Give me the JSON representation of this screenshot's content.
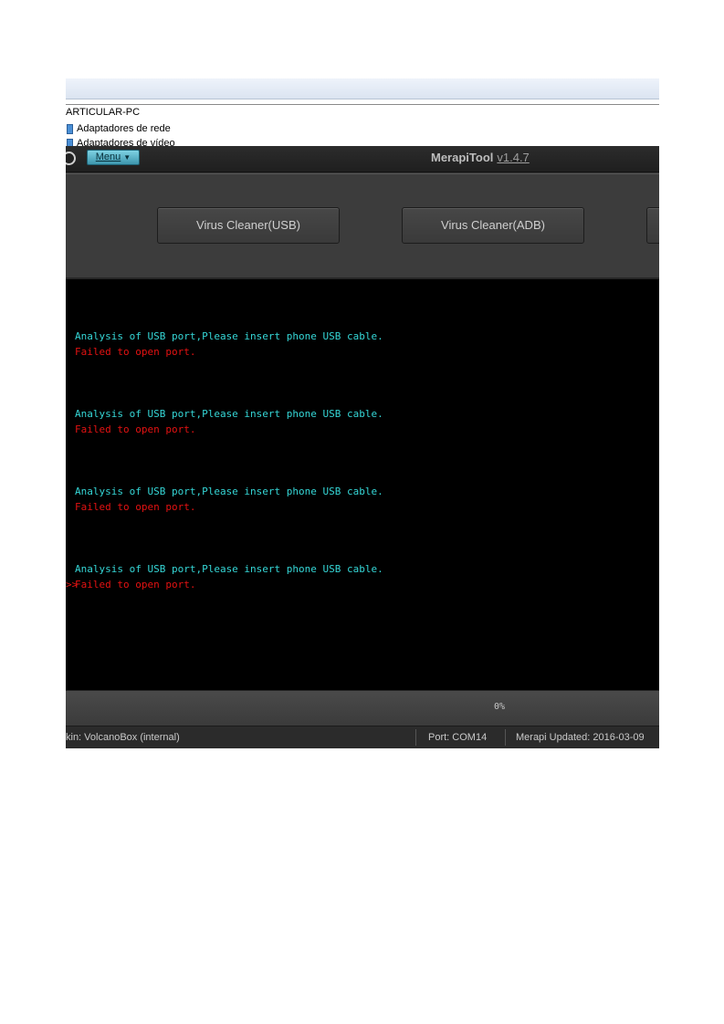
{
  "background_window": {
    "computer_name": "ARTICULAR-PC",
    "tree_items": [
      "Adaptadores de rede",
      "Adaptadores de vídeo"
    ]
  },
  "app": {
    "menu_label": "Menu",
    "title": "MerapiTool",
    "version": "v1.4.7",
    "toolbar": {
      "buttons": [
        "Virus Cleaner(USB)",
        "Virus Cleaner(ADB)"
      ]
    },
    "console": {
      "entries": [
        {
          "info": "Analysis of USB port,Please insert phone USB cable.",
          "error": "Failed to open port."
        },
        {
          "info": "Analysis of USB port,Please insert phone USB cable.",
          "error": "Failed to open port."
        },
        {
          "info": "Analysis of USB port,Please insert phone USB cable.",
          "error": "Failed to open port."
        },
        {
          "info": "Analysis of USB port,Please insert phone USB cable.",
          "error": "Failed to open port."
        }
      ],
      "prompt": ">>"
    },
    "progress": {
      "value": 0,
      "label": "0%"
    },
    "status": {
      "skin": "kin: VolcanoBox (internal)",
      "port": "Port: COM14",
      "updated": "Merapi Updated: 2016-03-09"
    }
  },
  "colors": {
    "console_info": "#35d6d6",
    "console_error": "#e41212",
    "menu_accent": "#3d96ad"
  }
}
